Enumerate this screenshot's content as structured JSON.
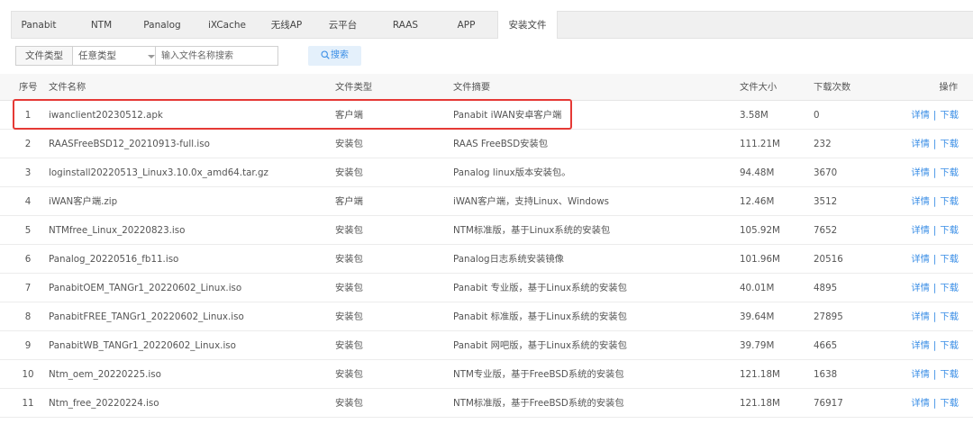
{
  "tabs": [
    {
      "label": "Panabit",
      "active": false
    },
    {
      "label": "NTM",
      "active": false
    },
    {
      "label": "Panalog",
      "active": false
    },
    {
      "label": "iXCache",
      "active": false
    },
    {
      "label": "无线AP",
      "active": false
    },
    {
      "label": "云平台",
      "active": false
    },
    {
      "label": "RAAS",
      "active": false
    },
    {
      "label": "APP",
      "active": false
    },
    {
      "label": "安装文件",
      "active": true
    }
  ],
  "filter": {
    "type_label": "文件类型",
    "type_selected": "任意类型",
    "search_placeholder": "输入文件名称搜索",
    "search_button": "搜索"
  },
  "table": {
    "headers": {
      "num": "序号",
      "name": "文件名称",
      "type": "文件类型",
      "desc": "文件摘要",
      "size": "文件大小",
      "count": "下载次数",
      "op": "操作"
    },
    "detail_label": "详情",
    "separator": "|",
    "download_label": "下载",
    "rows": [
      {
        "num": "1",
        "name": "iwanclient20230512.apk",
        "type": "客户端",
        "desc": "Panabit iWAN安卓客户端",
        "size": "3.58M",
        "count": "0"
      },
      {
        "num": "2",
        "name": "RAASFreeBSD12_20210913-full.iso",
        "type": "安装包",
        "desc": "RAAS FreeBSD安装包",
        "size": "111.21M",
        "count": "232"
      },
      {
        "num": "3",
        "name": "loginstall20220513_Linux3.10.0x_amd64.tar.gz",
        "type": "安装包",
        "desc": "Panalog linux版本安装包。",
        "size": "94.48M",
        "count": "3670"
      },
      {
        "num": "4",
        "name": "iWAN客户端.zip",
        "type": "客户端",
        "desc": "iWAN客户端，支持Linux、Windows",
        "size": "12.46M",
        "count": "3512"
      },
      {
        "num": "5",
        "name": "NTMfree_Linux_20220823.iso",
        "type": "安装包",
        "desc": "NTM标准版，基于Linux系统的安装包",
        "size": "105.92M",
        "count": "7652"
      },
      {
        "num": "6",
        "name": "Panalog_20220516_fb11.iso",
        "type": "安装包",
        "desc": "Panalog日志系统安装镜像",
        "size": "101.96M",
        "count": "20516"
      },
      {
        "num": "7",
        "name": "PanabitOEM_TANGr1_20220602_Linux.iso",
        "type": "安装包",
        "desc": "Panabit 专业版，基于Linux系统的安装包",
        "size": "40.01M",
        "count": "4895"
      },
      {
        "num": "8",
        "name": "PanabitFREE_TANGr1_20220602_Linux.iso",
        "type": "安装包",
        "desc": "Panabit 标准版，基于Linux系统的安装包",
        "size": "39.64M",
        "count": "27895"
      },
      {
        "num": "9",
        "name": "PanabitWB_TANGr1_20220602_Linux.iso",
        "type": "安装包",
        "desc": "Panabit 网吧版，基于Linux系统的安装包",
        "size": "39.79M",
        "count": "4665"
      },
      {
        "num": "10",
        "name": "Ntm_oem_20220225.iso",
        "type": "安装包",
        "desc": "NTM专业版，基于FreeBSD系统的安装包",
        "size": "121.18M",
        "count": "1638"
      },
      {
        "num": "11",
        "name": "Ntm_free_20220224.iso",
        "type": "安装包",
        "desc": "NTM标准版，基于FreeBSD系统的安装包",
        "size": "121.18M",
        "count": "76917"
      }
    ]
  },
  "colors": {
    "link": "#3a8ee6",
    "highlight_border": "#e53935",
    "tab_bar_bg": "#f0f0f0",
    "header_bg": "#f7f7f7"
  }
}
